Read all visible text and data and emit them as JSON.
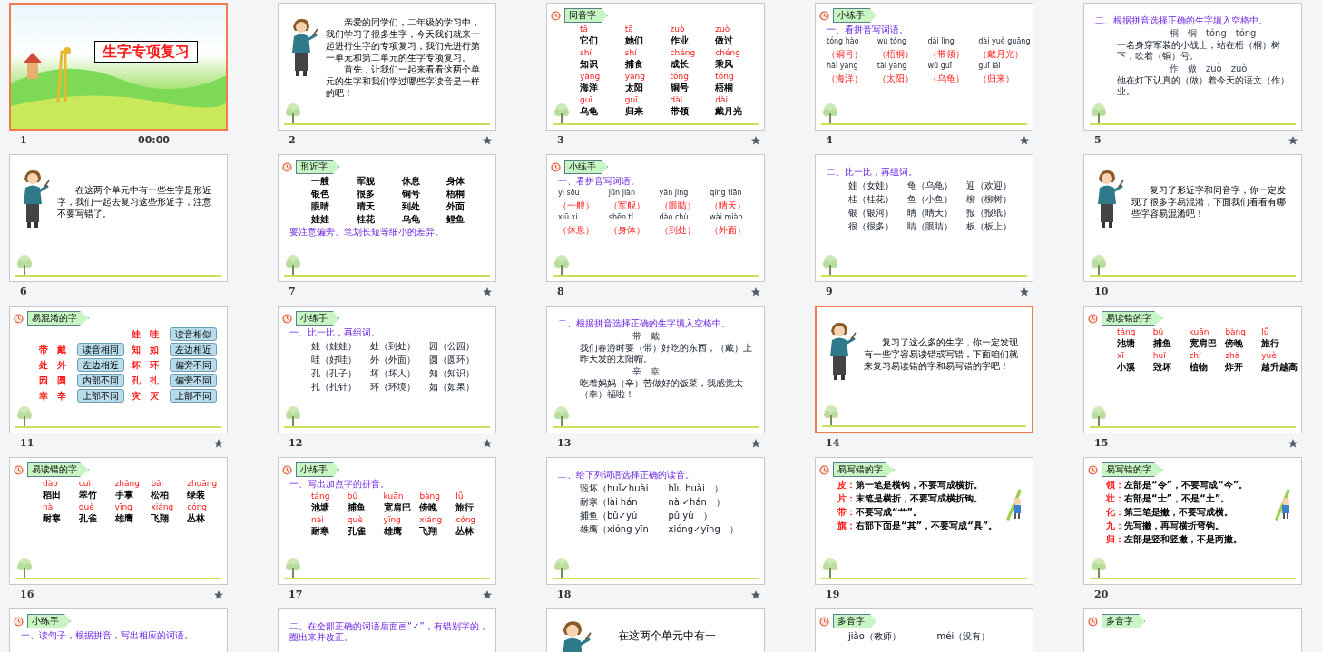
{
  "slides": [
    {
      "number": "1",
      "kind": "title",
      "selected": true,
      "animated": false,
      "title": "生字专项复习",
      "time": "00:00"
    },
    {
      "number": "2",
      "kind": "teacher",
      "selected": false,
      "animated": true,
      "paragraphs": [
        "亲爱的同学们，二年级的学习中，我们学习了很多生字，今天我们就来一起进行生字的专项复习，我们先进行第一单元和第二单元的生字专项复习。",
        "首先，让我们一起来看看这两个单元的生字和我们学过哪些字读音是一样的吧！"
      ]
    },
    {
      "number": "3",
      "kind": "content",
      "selected": false,
      "animated": true,
      "tag": "同音字",
      "rows": [
        {
          "kind": "pinyin",
          "cells": [
            "tā",
            "tā",
            "zuò",
            "zuò"
          ]
        },
        {
          "kind": "word",
          "cells": [
            "它们",
            "她们",
            "作业",
            "做过"
          ]
        },
        {
          "kind": "pinyin",
          "cells": [
            "shí",
            "shí",
            "chéng",
            "chéng"
          ]
        },
        {
          "kind": "word",
          "cells": [
            "知识",
            "捕食",
            "成长",
            "乘风"
          ]
        },
        {
          "kind": "pinyin",
          "cells": [
            "yáng",
            "yáng",
            "tóng",
            "tóng"
          ]
        },
        {
          "kind": "word",
          "cells": [
            "海洋",
            "太阳",
            "铜号",
            "梧桐"
          ]
        },
        {
          "kind": "pinyin",
          "cells": [
            "guī",
            "guī",
            "dài",
            "dài"
          ]
        },
        {
          "kind": "word",
          "cells": [
            "乌龟",
            "归来",
            "带领",
            "戴月光"
          ]
        }
      ]
    },
    {
      "number": "4",
      "kind": "content",
      "selected": false,
      "animated": true,
      "tag": "小练手",
      "rows": [
        {
          "kind": "note",
          "cells": [
            "一、看拼音写词语。"
          ]
        },
        {
          "kind": "spell",
          "cells": [
            "tóng hào",
            "wú tóng",
            "dài lǐng",
            "dài yuè guāng"
          ]
        },
        {
          "kind": "answer",
          "cells": [
            "（铜号）",
            "（梧桐）",
            "（带领）",
            "（戴月光）"
          ]
        },
        {
          "kind": "spell",
          "cells": [
            "hǎi yáng",
            "tài yáng",
            "wū guī",
            "guī lái"
          ]
        },
        {
          "kind": "answer",
          "cells": [
            "（海洋）",
            "（太阳）",
            "（乌龟）",
            "（归来）"
          ]
        }
      ]
    },
    {
      "number": "5",
      "kind": "content",
      "selected": false,
      "animated": true,
      "rows": [
        {
          "kind": "note",
          "cells": [
            "二、根据拼音选择正确的生字填入空格中。"
          ]
        },
        {
          "kind": "hint",
          "cells": [
            "桐　铜　tóng　tóng"
          ]
        },
        {
          "kind": "text",
          "cells": [
            "一名身穿军装的小战士，站在梧（桐）树下，吹着（铜）号。"
          ]
        },
        {
          "kind": "hint",
          "cells": [
            "作　做　zuò　zuò"
          ]
        },
        {
          "kind": "text",
          "cells": [
            "他在灯下认真的（做）着今天的语文（作）业。"
          ]
        }
      ]
    },
    {
      "number": "6",
      "kind": "teacher",
      "selected": false,
      "animated": false,
      "paragraphs": [
        "在这两个单元中有一些生字是形近字，我们一起去复习这些形近字，注意不要写错了。"
      ]
    },
    {
      "number": "7",
      "kind": "content",
      "selected": false,
      "animated": true,
      "tag": "形近字",
      "rows": [
        {
          "kind": "word",
          "cells": [
            "一艘",
            "军舰",
            "休息",
            "身体"
          ]
        },
        {
          "kind": "word",
          "cells": [
            "银色",
            "很多",
            "铜号",
            "梧桐"
          ]
        },
        {
          "kind": "word",
          "cells": [
            "眼睛",
            "晴天",
            "到处",
            "外面"
          ]
        },
        {
          "kind": "word",
          "cells": [
            "娃娃",
            "桂花",
            "乌龟",
            "鲤鱼"
          ]
        },
        {
          "kind": "note",
          "cells": [
            "要注意偏旁、笔划长短等细小的差异。"
          ]
        }
      ]
    },
    {
      "number": "8",
      "kind": "content",
      "selected": false,
      "animated": true,
      "tag": "小练手",
      "rows": [
        {
          "kind": "note",
          "cells": [
            "一、看拼音写词语。"
          ]
        },
        {
          "kind": "spell",
          "cells": [
            "yì sōu",
            "jūn jiàn",
            "yǎn jing",
            "qíng tiān"
          ]
        },
        {
          "kind": "answer",
          "cells": [
            "（一艘）",
            "（军舰）",
            "（眼睛）",
            "（晴天）"
          ]
        },
        {
          "kind": "spell",
          "cells": [
            "xiū xi",
            "shēn tǐ",
            "dào chù",
            "wài miàn"
          ]
        },
        {
          "kind": "answer",
          "cells": [
            "（休息）",
            "（身体）",
            "（到处）",
            "（外面）"
          ]
        }
      ]
    },
    {
      "number": "9",
      "kind": "content",
      "selected": false,
      "animated": true,
      "rows": [
        {
          "kind": "note",
          "cells": [
            "二、比一比，再组词。"
          ]
        },
        {
          "kind": "compare",
          "cells": [
            "娃（女娃）",
            "龟（乌龟）",
            "迎（欢迎）"
          ]
        },
        {
          "kind": "compare",
          "cells": [
            "桂（桂花）",
            "鱼（小鱼）",
            "柳（柳树）"
          ]
        },
        {
          "kind": "compare",
          "cells": [
            "银（银河）",
            "晴（晴天）",
            "报（报纸）"
          ]
        },
        {
          "kind": "compare",
          "cells": [
            "很（很多）",
            "睛（眼睛）",
            "板（板上）"
          ]
        }
      ]
    },
    {
      "number": "10",
      "kind": "teacher",
      "selected": false,
      "animated": false,
      "paragraphs": [
        "复习了形近字和同音字，你一定发现了很多字易混淆，下面我们看看有哪些字容易混淆吧！"
      ]
    },
    {
      "number": "11",
      "kind": "content",
      "selected": false,
      "animated": true,
      "tag": "易混淆的字",
      "rows": [
        {
          "kind": "pair",
          "cells": [
            "",
            "",
            "娃　哇",
            "读音相似"
          ]
        },
        {
          "kind": "pair",
          "cells": [
            "带　戴",
            "读音相同",
            "知　如",
            "左边相近"
          ]
        },
        {
          "kind": "pair",
          "cells": [
            "处　外",
            "左边相近",
            "坏　环",
            "偏旁不同"
          ]
        },
        {
          "kind": "pair",
          "cells": [
            "园　圆",
            "内部不同",
            "孔　扎",
            "偏旁不同"
          ]
        },
        {
          "kind": "pair",
          "cells": [
            "幸　辛",
            "上部不同",
            "灾　灭",
            "上部不同"
          ]
        }
      ]
    },
    {
      "number": "12",
      "kind": "content",
      "selected": false,
      "animated": true,
      "tag": "小练手",
      "rows": [
        {
          "kind": "note",
          "cells": [
            "一、比一比，再组词。"
          ]
        },
        {
          "kind": "compare",
          "cells": [
            "娃（娃娃）",
            "处（到处）",
            "园（公园）"
          ]
        },
        {
          "kind": "compare",
          "cells": [
            "哇（好哇）",
            "外（外面）",
            "圆（圆环）"
          ]
        },
        {
          "kind": "compare",
          "cells": [
            "孔（孔子）",
            "坏（坏人）",
            "知（知识）"
          ]
        },
        {
          "kind": "compare",
          "cells": [
            "扎（扎针）",
            "环（环境）",
            "如（如果）"
          ]
        }
      ]
    },
    {
      "number": "13",
      "kind": "content",
      "selected": false,
      "animated": true,
      "rows": [
        {
          "kind": "note",
          "cells": [
            "二、根据拼音选择正确的生字填入空格中。"
          ]
        },
        {
          "kind": "hint",
          "cells": [
            "带　戴"
          ]
        },
        {
          "kind": "text",
          "cells": [
            "我们春游时要（带）好吃的东西，（戴）上昨天发的太阳帽。"
          ]
        },
        {
          "kind": "hint",
          "cells": [
            "辛　幸"
          ]
        },
        {
          "kind": "text",
          "cells": [
            "吃着妈妈（辛）苦做好的饭菜，我感觉太（幸）福啦！"
          ]
        }
      ]
    },
    {
      "number": "14",
      "kind": "teacher",
      "selected": true,
      "animated": false,
      "paragraphs": [
        "复习了这么多的生字，你一定发现有一些字容易读错或写错，下面咱们就来复习易读错的字和易写错的字吧！"
      ]
    },
    {
      "number": "15",
      "kind": "content",
      "selected": false,
      "animated": true,
      "tag": "易读错的字",
      "rows": [
        {
          "kind": "pinyin",
          "cells": [
            "táng",
            "bǔ",
            "kuān",
            "bàng",
            "lǚ"
          ]
        },
        {
          "kind": "word",
          "cells": [
            "池塘",
            "捕鱼",
            "宽肩巴",
            "傍晚",
            "旅行"
          ]
        },
        {
          "kind": "pinyin",
          "cells": [
            "xī",
            "huǐ",
            "zhí",
            "zhà",
            "yuè"
          ]
        },
        {
          "kind": "word",
          "cells": [
            "小溪",
            "毁坏",
            "植物",
            "炸开",
            "越升越高"
          ]
        }
      ]
    },
    {
      "number": "16",
      "kind": "content",
      "selected": false,
      "animated": true,
      "tag": "易读错的字",
      "rows": [
        {
          "kind": "pinyin",
          "cells": [
            "dào",
            "cuì",
            "zhǎng",
            "bǎi",
            "zhuāng"
          ]
        },
        {
          "kind": "word",
          "cells": [
            "稻田",
            "翠竹",
            "手掌",
            "松柏",
            "绿装"
          ]
        },
        {
          "kind": "pinyin",
          "cells": [
            "nài",
            "què",
            "yīng",
            "xiáng",
            "cóng"
          ]
        },
        {
          "kind": "word",
          "cells": [
            "耐寒",
            "孔雀",
            "雄鹰",
            "飞翔",
            "丛林"
          ]
        }
      ]
    },
    {
      "number": "17",
      "kind": "content",
      "selected": false,
      "animated": true,
      "tag": "小练手",
      "rows": [
        {
          "kind": "note",
          "cells": [
            "一、写出加点字的拼音。"
          ]
        },
        {
          "kind": "pinyin",
          "cells": [
            "táng",
            "bǔ",
            "kuān",
            "bàng",
            "lǚ"
          ]
        },
        {
          "kind": "word",
          "cells": [
            "池塘",
            "捕鱼",
            "宽肩巴",
            "傍晚",
            "旅行"
          ]
        },
        {
          "kind": "pinyin",
          "cells": [
            "nài",
            "què",
            "yīng",
            "xiáng",
            "cóng"
          ]
        },
        {
          "kind": "word",
          "cells": [
            "耐寒",
            "孔雀",
            "雄鹰",
            "飞翔",
            "丛林"
          ]
        }
      ]
    },
    {
      "number": "18",
      "kind": "content",
      "selected": false,
      "animated": true,
      "rows": [
        {
          "kind": "note",
          "cells": [
            "二、给下列词语选择正确的读音。"
          ]
        },
        {
          "kind": "option",
          "cells": [
            "毁坏（huǐ✓huài",
            "hǐu huài　）"
          ]
        },
        {
          "kind": "option",
          "cells": [
            "耐寒（lài hán",
            "nài✓hán　）"
          ]
        },
        {
          "kind": "option",
          "cells": [
            "捕鱼（bǔ✓yú",
            "pǔ yú　）"
          ]
        },
        {
          "kind": "option",
          "cells": [
            "雄鹰（xióng yīn",
            "xióng✓yīng　）"
          ]
        }
      ]
    },
    {
      "number": "19",
      "kind": "content",
      "selected": false,
      "animated": false,
      "tag": "易写错的字",
      "pencil": true,
      "rows": [
        {
          "kind": "rule",
          "cells": [
            "皮：",
            "第一笔是横钩，不要写成横折。"
          ]
        },
        {
          "kind": "rule",
          "cells": [
            "片：",
            "末笔是横折，不要写成横折钩。"
          ]
        },
        {
          "kind": "rule",
          "cells": [
            "带：",
            "不要写成“艹”。"
          ]
        },
        {
          "kind": "rule",
          "cells": [
            "旗：",
            "右部下面是“其”，不要写成“具”。"
          ]
        }
      ]
    },
    {
      "number": "20",
      "kind": "content",
      "selected": false,
      "animated": false,
      "tag": "易写错的字",
      "pencil": true,
      "rows": [
        {
          "kind": "rule",
          "cells": [
            "领：",
            "左部是“令”，不要写成“今”。"
          ]
        },
        {
          "kind": "rule",
          "cells": [
            "壮：",
            "右部是“士”，不是“土”。"
          ]
        },
        {
          "kind": "rule",
          "cells": [
            "化：",
            "第三笔是撇，不要写成横。"
          ]
        },
        {
          "kind": "rule",
          "cells": [
            "九：",
            "先写撇，再写横折弯钩。"
          ]
        },
        {
          "kind": "rule",
          "cells": [
            "归：",
            "左部是竖和竖撇，不是两撇。"
          ]
        }
      ]
    },
    {
      "kind": "content",
      "selected": false,
      "tag": "小练手",
      "rows": [
        {
          "kind": "note",
          "cells": [
            "一、读句子，根据拼音，写出相应的词语。"
          ]
        }
      ]
    },
    {
      "kind": "content",
      "selected": false,
      "rows": [
        {
          "kind": "note",
          "cells": [
            "二、在全部正确的词语后面画“✓”，有错别字的，圈出来并改正。"
          ]
        }
      ]
    },
    {
      "kind": "teacher",
      "selected": false,
      "paragraphs": [
        "在这两个单元中有一"
      ]
    },
    {
      "kind": "content",
      "selected": false,
      "tag": "多音字",
      "rows": [
        {
          "kind": "compare",
          "cells": [
            "jiào（教师）",
            "méi（没有）"
          ]
        }
      ]
    },
    {
      "kind": "content",
      "selected": false,
      "tag": "多音字"
    }
  ]
}
